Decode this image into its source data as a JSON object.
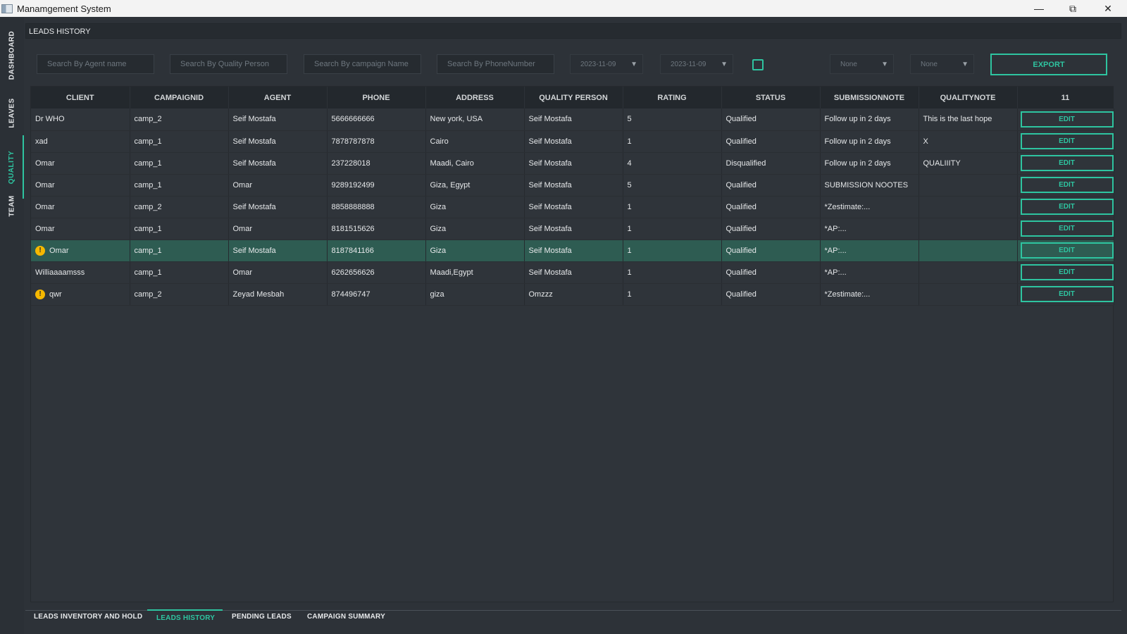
{
  "window": {
    "title": "Manamgement System",
    "min_icon": "minimize-icon",
    "max_icon": "restore-icon",
    "close_icon": "close-icon"
  },
  "sidenav": {
    "items": [
      {
        "label": "DASHBOARD",
        "active": false
      },
      {
        "label": "LEAVES",
        "active": false
      },
      {
        "label": "QUALITY",
        "active": true
      },
      {
        "label": "TEAM",
        "active": false
      }
    ]
  },
  "header": {
    "title": "LEADS HISTORY"
  },
  "filters": {
    "agent_placeholder": "Search By Agent name",
    "quality_placeholder": "Search By Quality Person",
    "campaign_placeholder": "Search By campaign Name",
    "phone_placeholder": "Search By PhoneNumber",
    "date_from": "2023-11-09",
    "date_to": "2023-11-09",
    "select1": "None",
    "select2": "None",
    "export_label": "EXPORT"
  },
  "table": {
    "columns": [
      "CLIENT",
      "CAMPAIGNID",
      "AGENT",
      "PHONE",
      "ADDRESS",
      "QUALITY PERSON",
      "RATING",
      "STATUS",
      "SUBMISSIONNOTE",
      "QUALITYNOTE",
      "11"
    ],
    "edit_label": "EDIT",
    "rows": [
      {
        "client": "Dr WHO",
        "campaign": "camp_2",
        "agent": "Seif Mostafa",
        "phone": "5666666666",
        "address": "New york, USA",
        "quality": "Seif Mostafa",
        "rating": "5",
        "status": "Qualified",
        "submission": "Follow up in 2 days",
        "qnote": "This is the last hope",
        "warn": false,
        "selected": false
      },
      {
        "client": "xad",
        "campaign": "camp_1",
        "agent": "Seif Mostafa",
        "phone": "7878787878",
        "address": "Cairo",
        "quality": "Seif Mostafa",
        "rating": "1",
        "status": "Qualified",
        "submission": "Follow up in 2 days",
        "qnote": "X",
        "warn": false,
        "selected": false
      },
      {
        "client": "Omar",
        "campaign": "camp_1",
        "agent": "Seif Mostafa",
        "phone": "237228018",
        "address": "Maadi, Cairo",
        "quality": "Seif Mostafa",
        "rating": "4",
        "status": "Disqualified",
        "submission": "Follow up in 2 days",
        "qnote": "QUALIIITY",
        "warn": false,
        "selected": false
      },
      {
        "client": "Omar",
        "campaign": "camp_1",
        "agent": "Omar",
        "phone": "9289192499",
        "address": "Giza, Egypt",
        "quality": "Seif Mostafa",
        "rating": "5",
        "status": "Qualified",
        "submission": "SUBMISSION NOOTES",
        "qnote": "",
        "warn": false,
        "selected": false
      },
      {
        "client": "Omar",
        "campaign": "camp_2",
        "agent": "Seif Mostafa",
        "phone": "8858888888",
        "address": "Giza",
        "quality": "Seif Mostafa",
        "rating": "1",
        "status": "Qualified",
        "submission": "*Zestimate:...",
        "qnote": "",
        "warn": false,
        "selected": false
      },
      {
        "client": "Omar",
        "campaign": "camp_1",
        "agent": "Omar",
        "phone": "8181515626",
        "address": "Giza",
        "quality": "Seif Mostafa",
        "rating": "1",
        "status": "Qualified",
        "submission": "*AP:...",
        "qnote": "",
        "warn": false,
        "selected": false
      },
      {
        "client": "Omar",
        "campaign": "camp_1",
        "agent": "Seif Mostafa",
        "phone": "8187841166",
        "address": "Giza",
        "quality": "Seif Mostafa",
        "rating": "1",
        "status": "Qualified",
        "submission": "*AP:...",
        "qnote": "",
        "warn": true,
        "selected": true
      },
      {
        "client": "Williaaaamsss",
        "campaign": "camp_1",
        "agent": "Omar",
        "phone": "6262656626",
        "address": "Maadi,Egypt",
        "quality": "Seif Mostafa",
        "rating": "1",
        "status": "Qualified",
        "submission": "*AP:...",
        "qnote": "",
        "warn": false,
        "selected": false
      },
      {
        "client": "qwr",
        "campaign": "camp_2",
        "agent": "Zeyad Mesbah",
        "phone": "874496747",
        "address": "giza",
        "quality": "Omzzz",
        "rating": "1",
        "status": "Qualified",
        "submission": "*Zestimate:...",
        "qnote": "",
        "warn": true,
        "selected": false
      }
    ]
  },
  "bottom_tabs": [
    {
      "label": "LEADS INVENTORY AND HOLD",
      "active": false
    },
    {
      "label": "LEADS HISTORY",
      "active": true
    },
    {
      "label": "PENDING LEADS",
      "active": false
    },
    {
      "label": "CAMPAIGN SUMMARY",
      "active": false
    }
  ],
  "colors": {
    "accent": "#2ec4a0",
    "background": "#2d3238",
    "selected_row": "#2e5c52",
    "warning": "#f5b800"
  }
}
